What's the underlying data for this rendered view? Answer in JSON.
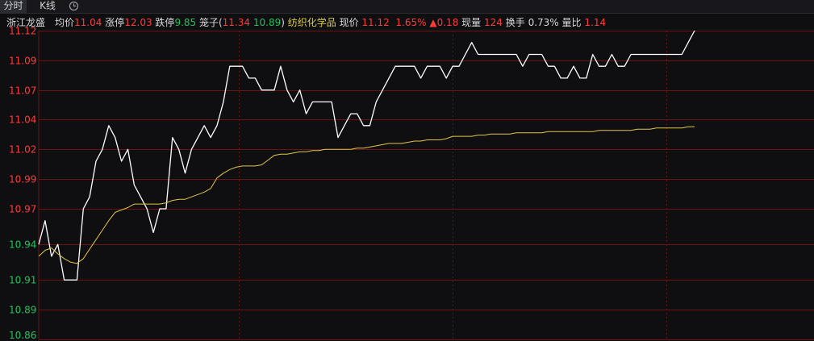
{
  "tabs": {
    "time_share": "分时",
    "kline": "K线",
    "history_icon": "clock-icon"
  },
  "info": {
    "stock_name": "浙江龙盛",
    "avg_label": "均价",
    "avg_value": "11.04",
    "limit_up_label": "涨停",
    "limit_up_value": "12.03",
    "limit_down_label": "跌停",
    "limit_down_value": "9.85",
    "cage_label": "笼子(",
    "cage_high": "11.34",
    "cage_low": "10.89",
    "cage_close": ")",
    "sector": "纺织化学品",
    "price_label": "现价",
    "price_value": "11.12",
    "change_pct": "1.65%",
    "change_value": "▲0.18",
    "volume_label": "现量",
    "volume_value": "124",
    "turnover_label": "换手",
    "turnover_value": "0.73%",
    "vol_ratio_label": "量比",
    "vol_ratio_value": "1.14"
  },
  "colors": {
    "up": "#ff3b3b",
    "down": "#22c35e",
    "price_line": "#ffffff",
    "avg_line": "#e0c54a",
    "grid": "#6b1414",
    "bg": "#0f0f12"
  },
  "chart_data": {
    "type": "line",
    "title": "",
    "xlabel": "",
    "ylabel": "",
    "ylim": [
      10.86,
      11.12
    ],
    "y_ticks": [
      {
        "label": "11.12",
        "value": 11.12,
        "color": "up"
      },
      {
        "label": "11.09",
        "value": 11.095,
        "color": "up"
      },
      {
        "label": "11.07",
        "value": 11.07,
        "color": "up"
      },
      {
        "label": "11.04",
        "value": 11.045,
        "color": "up"
      },
      {
        "label": "11.02",
        "value": 11.02,
        "color": "up"
      },
      {
        "label": "10.99",
        "value": 10.995,
        "color": "up"
      },
      {
        "label": "10.97",
        "value": 10.97,
        "color": "up"
      },
      {
        "label": "10.94",
        "value": 10.94,
        "color": "down"
      },
      {
        "label": "10.91",
        "value": 10.91,
        "color": "down"
      },
      {
        "label": "10.89",
        "value": 10.885,
        "color": "down"
      },
      {
        "label": "10.86",
        "value": 10.86,
        "color": "down"
      }
    ],
    "grid": true,
    "x_vertical_grid": [
      0.258,
      0.534,
      0.81
    ],
    "series": [
      {
        "key": "price",
        "values": [
          10.94,
          10.96,
          10.93,
          10.94,
          10.91,
          10.91,
          10.91,
          10.97,
          10.98,
          11.01,
          11.02,
          11.04,
          11.03,
          11.01,
          11.02,
          10.99,
          10.98,
          10.97,
          10.95,
          10.97,
          10.97,
          11.03,
          11.02,
          11.0,
          11.02,
          11.03,
          11.04,
          11.03,
          11.04,
          11.06,
          11.09,
          11.09,
          11.09,
          11.08,
          11.08,
          11.07,
          11.07,
          11.07,
          11.09,
          11.07,
          11.06,
          11.07,
          11.05,
          11.06,
          11.06,
          11.06,
          11.06,
          11.03,
          11.04,
          11.05,
          11.05,
          11.04,
          11.04,
          11.06,
          11.07,
          11.08,
          11.09,
          11.09,
          11.09,
          11.09,
          11.08,
          11.09,
          11.09,
          11.09,
          11.08,
          11.09,
          11.09,
          11.1,
          11.11,
          11.1,
          11.1,
          11.1,
          11.1,
          11.1,
          11.1,
          11.1,
          11.09,
          11.1,
          11.1,
          11.1,
          11.09,
          11.09,
          11.08,
          11.08,
          11.09,
          11.08,
          11.08,
          11.1,
          11.09,
          11.09,
          11.1,
          11.09,
          11.09,
          11.1,
          11.1,
          11.1,
          11.1,
          11.1,
          11.1,
          11.1,
          11.1,
          11.1,
          11.11,
          11.12
        ]
      },
      {
        "key": "average",
        "values": [
          10.93,
          10.935,
          10.937,
          10.932,
          10.928,
          10.925,
          10.924,
          10.928,
          10.936,
          10.944,
          10.952,
          10.96,
          10.967,
          10.969,
          10.971,
          10.974,
          10.974,
          10.974,
          10.974,
          10.974,
          10.975,
          10.977,
          10.978,
          10.978,
          10.98,
          10.982,
          10.984,
          10.987,
          10.996,
          11.0,
          11.003,
          11.005,
          11.006,
          11.006,
          11.006,
          11.007,
          11.011,
          11.015,
          11.016,
          11.016,
          11.017,
          11.018,
          11.018,
          11.019,
          11.019,
          11.02,
          11.02,
          11.02,
          11.02,
          11.02,
          11.021,
          11.021,
          11.022,
          11.023,
          11.024,
          11.025,
          11.025,
          11.025,
          11.026,
          11.027,
          11.027,
          11.028,
          11.028,
          11.028,
          11.029,
          11.031,
          11.031,
          11.031,
          11.031,
          11.032,
          11.032,
          11.033,
          11.033,
          11.033,
          11.033,
          11.034,
          11.034,
          11.034,
          11.034,
          11.034,
          11.035,
          11.035,
          11.035,
          11.035,
          11.035,
          11.035,
          11.035,
          11.035,
          11.036,
          11.036,
          11.036,
          11.036,
          11.036,
          11.036,
          11.037,
          11.037,
          11.037,
          11.038,
          11.038,
          11.038,
          11.038,
          11.038,
          11.039,
          11.039
        ]
      }
    ]
  }
}
